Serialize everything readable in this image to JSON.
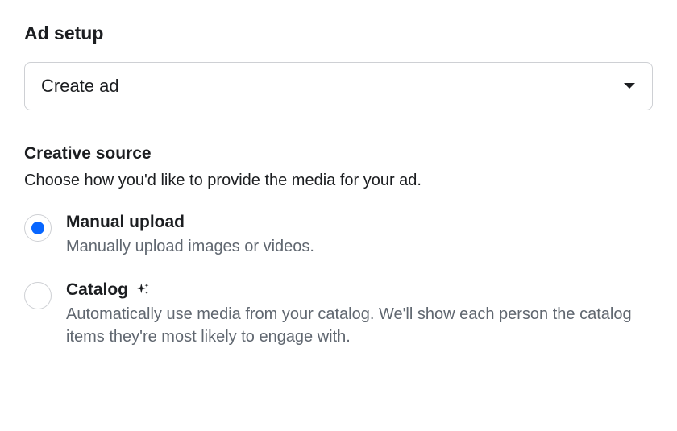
{
  "section_title": "Ad setup",
  "dropdown": {
    "label": "Create ad"
  },
  "creative_source": {
    "title": "Creative source",
    "description": "Choose how you'd like to provide the media for your ad.",
    "options": [
      {
        "title": "Manual upload",
        "description": "Manually upload images or videos.",
        "selected": true,
        "icon": null
      },
      {
        "title": "Catalog",
        "description": "Automatically use media from your catalog. We'll show each person the catalog items they're most likely to engage with.",
        "selected": false,
        "icon": "sparkle"
      }
    ]
  }
}
